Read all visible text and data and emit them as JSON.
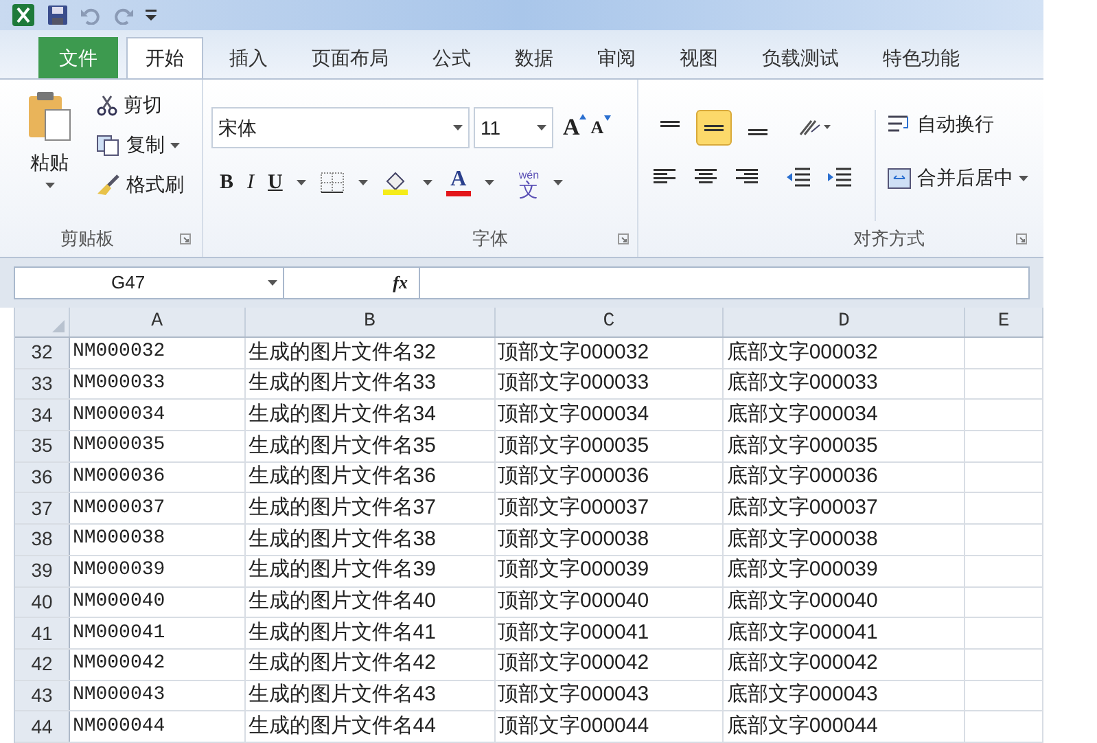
{
  "tabs": [
    {
      "label": "文件",
      "kind": "file",
      "selected": false
    },
    {
      "label": "开始",
      "kind": "tab",
      "selected": true
    },
    {
      "label": "插入",
      "kind": "tab",
      "selected": false
    },
    {
      "label": "页面布局",
      "kind": "tab",
      "selected": false
    },
    {
      "label": "公式",
      "kind": "tab",
      "selected": false
    },
    {
      "label": "数据",
      "kind": "tab",
      "selected": false
    },
    {
      "label": "审阅",
      "kind": "tab",
      "selected": false
    },
    {
      "label": "视图",
      "kind": "tab",
      "selected": false
    },
    {
      "label": "负载测试",
      "kind": "tab",
      "selected": false
    },
    {
      "label": "特色功能",
      "kind": "tab",
      "selected": false
    }
  ],
  "clipboard": {
    "label": "剪贴板",
    "paste": "粘贴",
    "cut": "剪切",
    "copy": "复制",
    "format_painter": "格式刷"
  },
  "font": {
    "label": "字体",
    "font_name": "宋体",
    "font_size": "11",
    "grow": "A",
    "shrink": "A",
    "bold": "B",
    "italic": "I",
    "underline": "U",
    "font_color": "A",
    "phonetic_top": "wén",
    "phonetic": "文"
  },
  "alignment": {
    "label": "对齐方式",
    "vertical": [
      {
        "selected": false
      },
      {
        "selected": true
      },
      {
        "selected": false
      }
    ],
    "wrap_text": "自动换行",
    "merge": "合并后居中"
  },
  "formula_bar": {
    "name_box": "G47",
    "fx": "fx"
  },
  "columns": [
    "A",
    "B",
    "C",
    "D",
    "E"
  ],
  "rows": [
    {
      "header": "32",
      "cells": [
        "NM000032",
        "生成的图片文件名32",
        "顶部文字000032",
        "底部文字000032"
      ]
    },
    {
      "header": "33",
      "cells": [
        "NM000033",
        "生成的图片文件名33",
        "顶部文字000033",
        "底部文字000033"
      ]
    },
    {
      "header": "34",
      "cells": [
        "NM000034",
        "生成的图片文件名34",
        "顶部文字000034",
        "底部文字000034"
      ]
    },
    {
      "header": "35",
      "cells": [
        "NM000035",
        "生成的图片文件名35",
        "顶部文字000035",
        "底部文字000035"
      ]
    },
    {
      "header": "36",
      "cells": [
        "NM000036",
        "生成的图片文件名36",
        "顶部文字000036",
        "底部文字000036"
      ]
    },
    {
      "header": "37",
      "cells": [
        "NM000037",
        "生成的图片文件名37",
        "顶部文字000037",
        "底部文字000037"
      ]
    },
    {
      "header": "38",
      "cells": [
        "NM000038",
        "生成的图片文件名38",
        "顶部文字000038",
        "底部文字000038"
      ]
    },
    {
      "header": "39",
      "cells": [
        "NM000039",
        "生成的图片文件名39",
        "顶部文字000039",
        "底部文字000039"
      ]
    },
    {
      "header": "40",
      "cells": [
        "NM000040",
        "生成的图片文件名40",
        "顶部文字000040",
        "底部文字000040"
      ]
    },
    {
      "header": "41",
      "cells": [
        "NM000041",
        "生成的图片文件名41",
        "顶部文字000041",
        "底部文字000041"
      ]
    },
    {
      "header": "42",
      "cells": [
        "NM000042",
        "生成的图片文件名42",
        "顶部文字000042",
        "底部文字000042"
      ]
    },
    {
      "header": "43",
      "cells": [
        "NM000043",
        "生成的图片文件名43",
        "顶部文字000043",
        "底部文字000043"
      ]
    },
    {
      "header": "44",
      "cells": [
        "NM000044",
        "生成的图片文件名44",
        "顶部文字000044",
        "底部文字000044"
      ]
    }
  ]
}
